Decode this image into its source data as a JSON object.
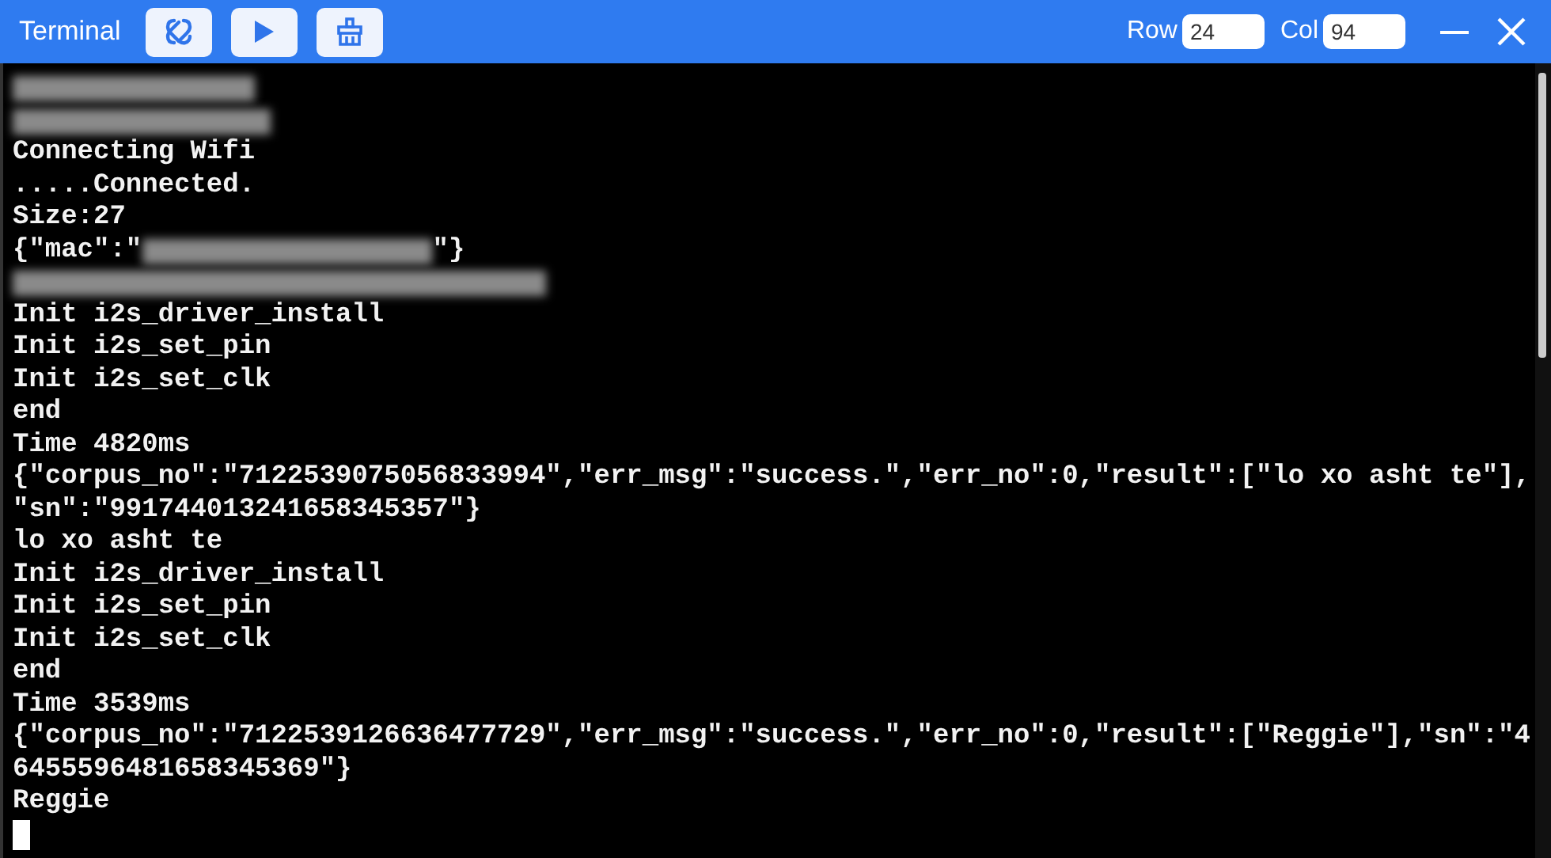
{
  "window": {
    "title": "Terminal"
  },
  "toolbar": [
    {
      "kind": "disconnect"
    },
    {
      "kind": "run"
    },
    {
      "kind": "clear"
    }
  ],
  "row": {
    "label": "Row",
    "value": "24"
  },
  "col": {
    "label": "Col",
    "value": "94"
  },
  "terminal": {
    "lines": [
      [
        {
          "kind": "redacted"
        }
      ],
      [
        {
          "kind": "redacted"
        }
      ],
      [
        {
          "kind": "text",
          "text": "Connecting Wifi"
        }
      ],
      [
        {
          "kind": "text",
          "text": ".....Connected."
        }
      ],
      [
        {
          "kind": "text",
          "text": "Size:27"
        }
      ],
      [
        {
          "kind": "text",
          "text": "{\"mac\":\""
        },
        {
          "kind": "redacted"
        },
        {
          "kind": "text",
          "text": "\"}"
        }
      ],
      [
        {
          "kind": "redacted"
        }
      ],
      [
        {
          "kind": "text",
          "text": "Init i2s_driver_install"
        }
      ],
      [
        {
          "kind": "text",
          "text": "Init i2s_set_pin"
        }
      ],
      [
        {
          "kind": "text",
          "text": "Init i2s_set_clk"
        }
      ],
      [
        {
          "kind": "text",
          "text": "end"
        }
      ],
      [
        {
          "kind": "text",
          "text": "Time 4820ms"
        }
      ],
      [
        {
          "kind": "text",
          "text": "{\"corpus_no\":\"7122539075056833994\",\"err_msg\":\"success.\",\"err_no\":0,\"result\":[\"lo xo asht te\"],"
        }
      ],
      [
        {
          "kind": "text",
          "text": "\"sn\":\"991744013241658345357\"}"
        }
      ],
      [
        {
          "kind": "text",
          "text": "lo xo asht te"
        }
      ],
      [
        {
          "kind": "text",
          "text": "Init i2s_driver_install"
        }
      ],
      [
        {
          "kind": "text",
          "text": "Init i2s_set_pin"
        }
      ],
      [
        {
          "kind": "text",
          "text": "Init i2s_set_clk"
        }
      ],
      [
        {
          "kind": "text",
          "text": "end"
        }
      ],
      [
        {
          "kind": "text",
          "text": "Time 3539ms"
        }
      ],
      [
        {
          "kind": "text",
          "text": "{\"corpus_no\":\"7122539126636477729\",\"err_msg\":\"success.\",\"err_no\":0,\"result\":[\"Reggie\"],\"sn\":\"4"
        }
      ],
      [
        {
          "kind": "text",
          "text": "6455596481658345369\"}"
        }
      ],
      [
        {
          "kind": "text",
          "text": "Reggie"
        }
      ],
      [
        {
          "kind": "cursor"
        }
      ]
    ]
  }
}
